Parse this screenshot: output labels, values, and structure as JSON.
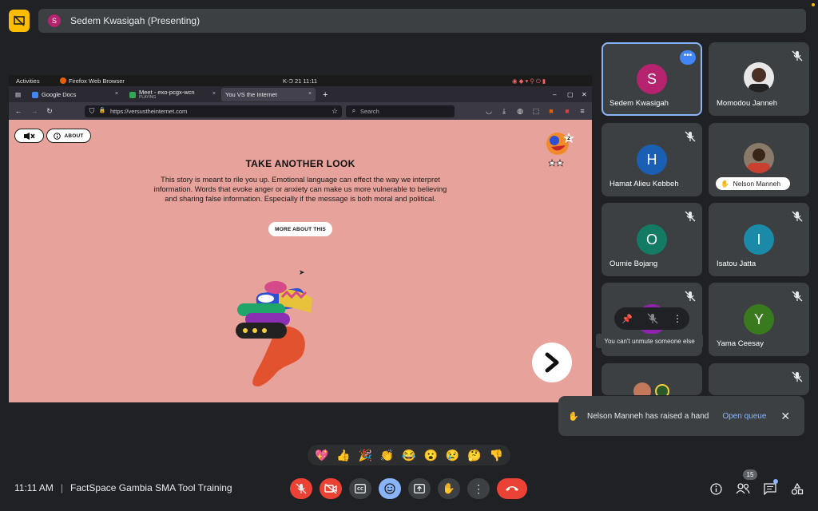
{
  "presenter_bar": {
    "avatar_letter": "S",
    "title": "Sedem Kwasigah (Presenting)"
  },
  "shared_screen": {
    "os": {
      "activities": "Activities",
      "app": "Firefox Web Browser",
      "clock": "K-Ɔ 21  11:11"
    },
    "tabs": [
      {
        "label": "Google Docs",
        "close": "×"
      },
      {
        "label": "Meet - exo-pcgx-wcn",
        "sublabel": "PLAYING",
        "close": "×"
      },
      {
        "label": "You VS the Internet",
        "close": "×"
      }
    ],
    "new_tab": "+",
    "url": "https://versustheinternet.com",
    "search_placeholder": "Search",
    "page": {
      "about_label": "ABOUT",
      "badge_count": "2",
      "title": "TAKE ANOTHER LOOK",
      "body": "This story is meant to rile you up. Emotional language can effect the way we interpret information. Words that evoke anger or anxiety can make us more vulnerable to believing and sharing false information. Especially if the message is both moral and political.",
      "more_label": "MORE ABOUT THIS"
    }
  },
  "participants": [
    {
      "name": "Sedem Kwasigah",
      "letter": "S",
      "color": "#b5226e",
      "active": true
    },
    {
      "name": "Momodou Janneh",
      "photo": true
    },
    {
      "name": "Hamat Alieu Kebbeh",
      "letter": "H",
      "color": "#1a5fb4"
    },
    {
      "name": "Nelson Manneh",
      "photo": true,
      "hand_raised": true
    },
    {
      "name": "Oumie Bojang",
      "letter": "O",
      "color": "#137a63"
    },
    {
      "name": "Isatou Jatta",
      "letter": "I",
      "color": "#1b8aa8"
    },
    {
      "name": "",
      "hover": true,
      "tooltip": "You can't unmute someone else"
    },
    {
      "name": "Yama Ceesay",
      "letter": "Y",
      "color": "#3a7a1f"
    },
    {
      "name": "",
      "photo": true
    },
    {
      "name": "",
      "letter": "",
      "color": "#1b8aa8"
    }
  ],
  "reactions": [
    "💖",
    "👍",
    "🎉",
    "👏",
    "😂",
    "😮",
    "😢",
    "🤔",
    "👎"
  ],
  "toast": {
    "message": "Nelson Manneh has raised a hand",
    "action": "Open queue"
  },
  "footer": {
    "time": "11:11 AM",
    "separator": "|",
    "meeting_name": "FactSpace Gambia SMA Tool Training",
    "participant_count": "15"
  }
}
